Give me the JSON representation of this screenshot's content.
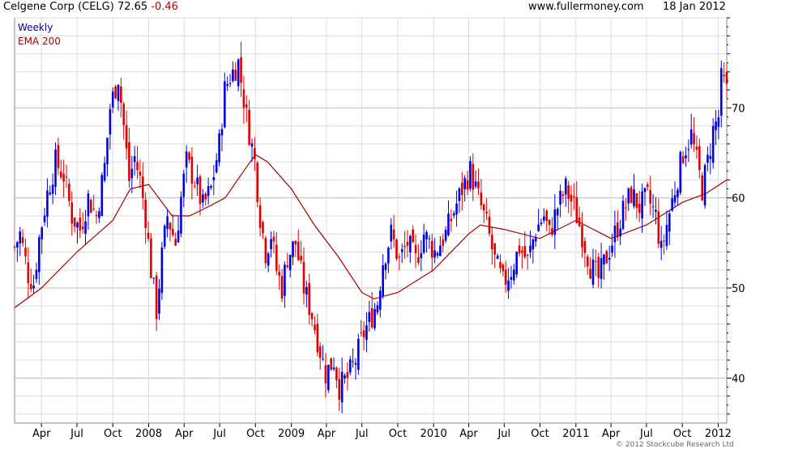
{
  "header": {
    "title": "Celgene Corp (CELG) 72.65",
    "change": "-0.46",
    "site": "www.fullermoney.com",
    "date": "18 Jan 2012"
  },
  "legend": {
    "weekly": "Weekly",
    "ema": "EMA 200"
  },
  "footer": {
    "copyright": "© 2012 Stockcube Research Ltd"
  },
  "colors": {
    "up": "#0000e0",
    "down": "#e00000",
    "ema": "#a00000",
    "grid": "#dcdcdc",
    "weekly_text": "#000099",
    "ema_text": "#990000"
  },
  "chart_data": {
    "type": "candlestick",
    "y_axis": {
      "side": "right",
      "min": 35,
      "max": 80,
      "ticks": [
        40,
        50,
        60,
        70
      ]
    },
    "x_axis": {
      "start": "2007-01-22",
      "end": "2012-01-23",
      "tick_labels": [
        {
          "date": "2007-04-01",
          "label": "Apr"
        },
        {
          "date": "2007-07-01",
          "label": "Jul"
        },
        {
          "date": "2007-10-01",
          "label": "Oct"
        },
        {
          "date": "2008-01-01",
          "label": "2008"
        },
        {
          "date": "2008-04-01",
          "label": "Apr"
        },
        {
          "date": "2008-07-01",
          "label": "Jul"
        },
        {
          "date": "2008-10-01",
          "label": "Oct"
        },
        {
          "date": "2009-01-01",
          "label": "2009"
        },
        {
          "date": "2009-04-01",
          "label": "Apr"
        },
        {
          "date": "2009-07-01",
          "label": "Jul"
        },
        {
          "date": "2009-10-01",
          "label": "Oct"
        },
        {
          "date": "2010-01-01",
          "label": "2010"
        },
        {
          "date": "2010-04-01",
          "label": "Apr"
        },
        {
          "date": "2010-07-01",
          "label": "Jul"
        },
        {
          "date": "2010-10-01",
          "label": "Oct"
        },
        {
          "date": "2011-01-01",
          "label": "2011"
        },
        {
          "date": "2011-04-01",
          "label": "Apr"
        },
        {
          "date": "2011-07-01",
          "label": "Jul"
        },
        {
          "date": "2011-10-01",
          "label": "Oct"
        },
        {
          "date": "2012-01-01",
          "label": "2012"
        }
      ]
    },
    "series": [
      {
        "name": "Weekly",
        "kind": "candles"
      },
      {
        "name": "EMA 200",
        "kind": "line"
      }
    ],
    "close_path": [
      [
        "2007-01-22",
        54.5
      ],
      [
        "2007-02-05",
        56.0
      ],
      [
        "2007-02-26",
        51.5
      ],
      [
        "2007-03-12",
        50.5
      ],
      [
        "2007-03-26",
        55.5
      ],
      [
        "2007-04-16",
        60.5
      ],
      [
        "2007-05-07",
        64.0
      ],
      [
        "2007-05-28",
        62.5
      ],
      [
        "2007-06-18",
        58.0
      ],
      [
        "2007-07-09",
        56.5
      ],
      [
        "2007-07-30",
        60.0
      ],
      [
        "2007-08-20",
        58.0
      ],
      [
        "2007-09-10",
        63.5
      ],
      [
        "2007-09-24",
        70.0
      ],
      [
        "2007-10-15",
        73.5
      ],
      [
        "2007-10-29",
        68.0
      ],
      [
        "2007-11-12",
        62.0
      ],
      [
        "2007-11-26",
        64.5
      ],
      [
        "2007-12-10",
        62.0
      ],
      [
        "2007-12-24",
        58.0
      ],
      [
        "2008-01-07",
        52.0
      ],
      [
        "2008-01-21",
        47.5
      ],
      [
        "2008-02-04",
        53.5
      ],
      [
        "2008-02-18",
        58.0
      ],
      [
        "2008-03-10",
        55.0
      ],
      [
        "2008-03-24",
        60.0
      ],
      [
        "2008-04-07",
        64.0
      ],
      [
        "2008-04-28",
        62.0
      ],
      [
        "2008-05-19",
        59.0
      ],
      [
        "2008-06-09",
        61.0
      ],
      [
        "2008-06-30",
        66.0
      ],
      [
        "2008-07-14",
        72.0
      ],
      [
        "2008-07-28",
        73.5
      ],
      [
        "2008-08-18",
        75.0
      ],
      [
        "2008-09-08",
        69.0
      ],
      [
        "2008-09-29",
        64.0
      ],
      [
        "2008-10-13",
        58.0
      ],
      [
        "2008-10-27",
        54.0
      ],
      [
        "2008-11-10",
        56.0
      ],
      [
        "2008-11-24",
        52.0
      ],
      [
        "2008-12-08",
        50.0
      ],
      [
        "2008-12-22",
        53.5
      ],
      [
        "2009-01-12",
        55.0
      ],
      [
        "2009-02-02",
        50.0
      ],
      [
        "2009-02-23",
        47.0
      ],
      [
        "2009-03-16",
        43.0
      ],
      [
        "2009-03-30",
        40.5
      ],
      [
        "2009-04-20",
        42.0
      ],
      [
        "2009-05-04",
        39.0
      ],
      [
        "2009-05-25",
        40.0
      ],
      [
        "2009-06-15",
        42.0
      ],
      [
        "2009-07-06",
        45.0
      ],
      [
        "2009-07-27",
        47.0
      ],
      [
        "2009-08-10",
        48.5
      ],
      [
        "2009-08-24",
        53.0
      ],
      [
        "2009-09-14",
        56.0
      ],
      [
        "2009-10-05",
        53.0
      ],
      [
        "2009-10-26",
        55.0
      ],
      [
        "2009-11-16",
        53.0
      ],
      [
        "2009-12-07",
        56.0
      ],
      [
        "2010-01-04",
        54.0
      ],
      [
        "2010-02-01",
        56.0
      ],
      [
        "2010-02-22",
        58.5
      ],
      [
        "2010-03-15",
        61.0
      ],
      [
        "2010-04-05",
        63.0
      ],
      [
        "2010-04-26",
        60.0
      ],
      [
        "2010-05-17",
        57.0
      ],
      [
        "2010-06-07",
        53.0
      ],
      [
        "2010-06-28",
        50.5
      ],
      [
        "2010-07-19",
        52.0
      ],
      [
        "2010-08-09",
        54.5
      ],
      [
        "2010-08-30",
        53.0
      ],
      [
        "2010-09-20",
        56.5
      ],
      [
        "2010-10-11",
        58.0
      ],
      [
        "2010-10-25",
        56.0
      ],
      [
        "2010-11-15",
        59.0
      ],
      [
        "2010-12-06",
        61.0
      ],
      [
        "2010-12-27",
        59.0
      ],
      [
        "2011-01-17",
        56.0
      ],
      [
        "2011-02-07",
        52.5
      ],
      [
        "2011-02-28",
        51.0
      ],
      [
        "2011-03-21",
        53.5
      ],
      [
        "2011-04-11",
        56.0
      ],
      [
        "2011-05-02",
        58.5
      ],
      [
        "2011-05-23",
        60.5
      ],
      [
        "2011-06-13",
        59.0
      ],
      [
        "2011-07-04",
        60.0
      ],
      [
        "2011-07-25",
        58.0
      ],
      [
        "2011-08-08",
        54.0
      ],
      [
        "2011-08-22",
        57.0
      ],
      [
        "2011-09-12",
        61.0
      ],
      [
        "2011-10-03",
        65.0
      ],
      [
        "2011-10-24",
        67.0
      ],
      [
        "2011-11-07",
        64.0
      ],
      [
        "2011-11-21",
        61.0
      ],
      [
        "2011-12-05",
        64.0
      ],
      [
        "2011-12-19",
        67.5
      ],
      [
        "2012-01-02",
        69.0
      ],
      [
        "2012-01-09",
        73.0
      ],
      [
        "2012-01-16",
        72.65
      ]
    ],
    "ema_200": [
      [
        "2007-01-22",
        47.8
      ],
      [
        "2007-04-01",
        50.0
      ],
      [
        "2007-07-01",
        54.0
      ],
      [
        "2007-10-01",
        57.5
      ],
      [
        "2007-11-15",
        61.0
      ],
      [
        "2008-01-01",
        61.5
      ],
      [
        "2008-03-01",
        58.0
      ],
      [
        "2008-04-15",
        58.0
      ],
      [
        "2008-06-01",
        59.0
      ],
      [
        "2008-07-15",
        60.0
      ],
      [
        "2008-09-01",
        63.0
      ],
      [
        "2008-10-01",
        64.8
      ],
      [
        "2008-11-01",
        64.0
      ],
      [
        "2009-01-01",
        61.0
      ],
      [
        "2009-03-01",
        57.0
      ],
      [
        "2009-05-01",
        53.5
      ],
      [
        "2009-07-01",
        49.5
      ],
      [
        "2009-08-01",
        48.8
      ],
      [
        "2009-10-01",
        49.5
      ],
      [
        "2010-01-01",
        52.0
      ],
      [
        "2010-04-01",
        56.0
      ],
      [
        "2010-05-01",
        57.0
      ],
      [
        "2010-07-01",
        56.5
      ],
      [
        "2010-10-01",
        55.5
      ],
      [
        "2011-01-01",
        57.5
      ],
      [
        "2011-04-01",
        55.5
      ],
      [
        "2011-07-01",
        57.0
      ],
      [
        "2011-10-01",
        59.5
      ],
      [
        "2011-12-01",
        60.5
      ],
      [
        "2012-01-23",
        62.0
      ]
    ],
    "volatility": 1.5
  }
}
